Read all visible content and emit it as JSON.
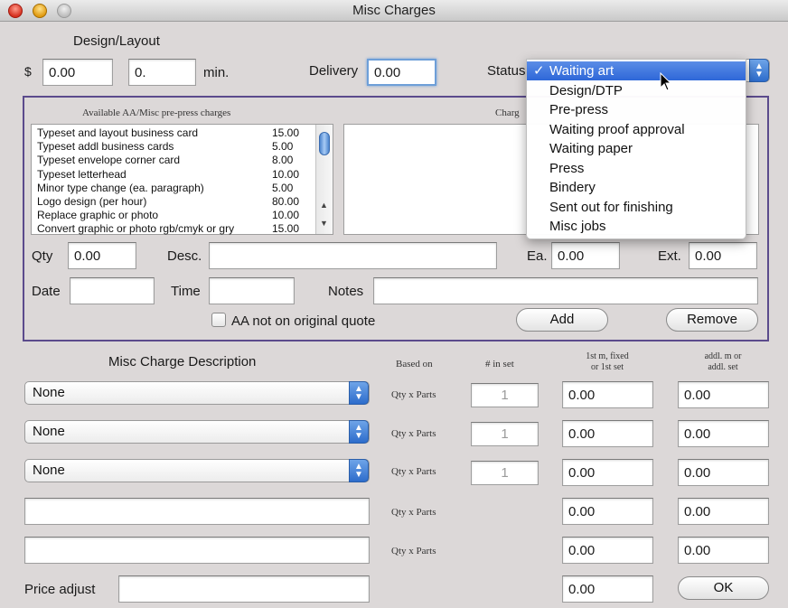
{
  "window": {
    "title": "Misc Charges"
  },
  "design_layout": {
    "heading": "Design/Layout",
    "currency_symbol": "$",
    "amount": "0.00",
    "minutes": "0.",
    "minutes_unit": "min."
  },
  "delivery": {
    "label": "Delivery",
    "value": "0.00"
  },
  "status": {
    "label": "Status",
    "options": [
      "Waiting art",
      "Design/DTP",
      "Pre-press",
      "Waiting proof approval",
      "Waiting paper",
      "Press",
      "Bindery",
      "Sent out for finishing",
      "Misc jobs"
    ],
    "selected": "Waiting art",
    "check": "✓"
  },
  "available": {
    "heading": "Available AA/Misc pre-press charges",
    "items": [
      {
        "desc": "Typeset and layout business card",
        "amount": "15.00"
      },
      {
        "desc": "Typeset addl business cards",
        "amount": "5.00"
      },
      {
        "desc": "Typeset envelope corner card",
        "amount": "8.00"
      },
      {
        "desc": "Typeset letterhead",
        "amount": "10.00"
      },
      {
        "desc": "Minor type change (ea. paragraph)",
        "amount": "5.00"
      },
      {
        "desc": "Logo design (per hour)",
        "amount": "80.00"
      },
      {
        "desc": "Replace graphic or photo",
        "amount": "10.00"
      },
      {
        "desc": "Convert graphic or photo rgb/cmyk or gry",
        "amount": "15.00"
      }
    ]
  },
  "charges_heading": "Charg",
  "entry": {
    "qty_label": "Qty",
    "qty": "0.00",
    "desc_label": "Desc.",
    "desc": "",
    "ea_label": "Ea.",
    "ea": "0.00",
    "ext_label": "Ext.",
    "ext": "0.00",
    "date_label": "Date",
    "date": "",
    "time_label": "Time",
    "time": "",
    "notes_label": "Notes",
    "notes": "",
    "aa_checkbox_label": "AA not on original quote",
    "aa_checked": false,
    "add_label": "Add",
    "remove_label": "Remove"
  },
  "misc_table": {
    "desc_header": "Misc Charge Description",
    "based_on_header": "Based on",
    "in_set_header": "# in set",
    "first_header_line1": "1st m, fixed",
    "first_header_line2": "or 1st set",
    "addl_header_line1": "addl. m or",
    "addl_header_line2": "addl. set",
    "rows": [
      {
        "desc": "None",
        "based_on": "Qty x Parts",
        "in_set": "1",
        "first": "0.00",
        "addl": "0.00"
      },
      {
        "desc": "None",
        "based_on": "Qty x Parts",
        "in_set": "1",
        "first": "0.00",
        "addl": "0.00"
      },
      {
        "desc": "None",
        "based_on": "Qty x Parts",
        "in_set": "1",
        "first": "0.00",
        "addl": "0.00"
      },
      {
        "desc": "",
        "based_on": "Qty x Parts",
        "first": "0.00",
        "addl": "0.00"
      },
      {
        "desc": "",
        "based_on": "Qty x Parts",
        "first": "0.00",
        "addl": "0.00"
      }
    ]
  },
  "price_adjust": {
    "label": "Price adjust",
    "value": "",
    "amount": "0.00"
  },
  "ok_label": "OK"
}
